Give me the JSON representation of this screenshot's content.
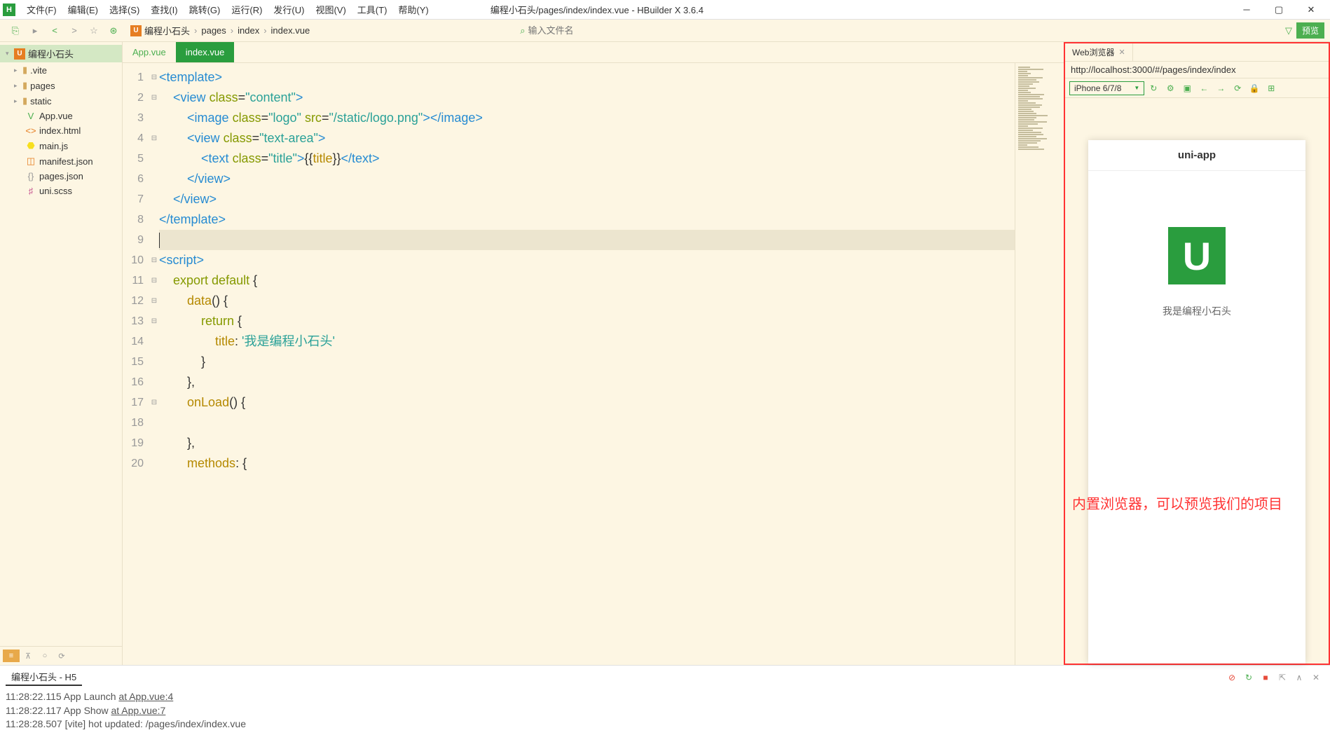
{
  "menubar": {
    "logo": "H",
    "items": [
      "文件(F)",
      "编辑(E)",
      "选择(S)",
      "查找(I)",
      "跳转(G)",
      "运行(R)",
      "发行(U)",
      "视图(V)",
      "工具(T)",
      "帮助(Y)"
    ],
    "title": "编程小石头/pages/index/index.vue - HBuilder X 3.6.4"
  },
  "toolbar": {
    "breadcrumb": [
      "编程小石头",
      "pages",
      "index",
      "index.vue"
    ],
    "search_placeholder": "输入文件名",
    "preview_label": "预览"
  },
  "sidebar": {
    "project": "编程小石头",
    "folders": [
      ".vite",
      "pages",
      "static"
    ],
    "files": [
      {
        "name": "App.vue",
        "icon": "V",
        "color": "#4caf50"
      },
      {
        "name": "index.html",
        "icon": "<>",
        "color": "#e67e22"
      },
      {
        "name": "main.js",
        "icon": "⬣",
        "color": "#f7df1e"
      },
      {
        "name": "manifest.json",
        "icon": "◫",
        "color": "#e67e22"
      },
      {
        "name": "pages.json",
        "icon": "{}",
        "color": "#999"
      },
      {
        "name": "uni.scss",
        "icon": "♯",
        "color": "#cc6699"
      }
    ]
  },
  "tabs": {
    "items": [
      "App.vue",
      "index.vue"
    ],
    "active": 1
  },
  "code": {
    "lines": [
      {
        "n": 1,
        "fold": "⊟",
        "html": "<span class='tag'>&lt;template&gt;</span>"
      },
      {
        "n": 2,
        "fold": "⊟",
        "html": "    <span class='tag'>&lt;view</span> <span class='attr'>class</span>=<span class='str'>\"content\"</span><span class='tag'>&gt;</span>"
      },
      {
        "n": 3,
        "fold": "",
        "html": "        <span class='tag'>&lt;image</span> <span class='attr'>class</span>=<span class='str'>\"logo\"</span> <span class='attr'>src</span>=<span class='str'>\"/static/logo.png\"</span><span class='tag'>&gt;&lt;/image&gt;</span>"
      },
      {
        "n": 4,
        "fold": "⊟",
        "html": "        <span class='tag'>&lt;view</span> <span class='attr'>class</span>=<span class='str'>\"text-area\"</span><span class='tag'>&gt;</span>"
      },
      {
        "n": 5,
        "fold": "",
        "html": "            <span class='tag'>&lt;text</span> <span class='attr'>class</span>=<span class='str'>\"title\"</span><span class='tag'>&gt;</span>{{<span class='var'>title</span>}}<span class='tag'>&lt;/text&gt;</span>"
      },
      {
        "n": 6,
        "fold": "",
        "html": "        <span class='tag'>&lt;/view&gt;</span>"
      },
      {
        "n": 7,
        "fold": "",
        "html": "    <span class='tag'>&lt;/view&gt;</span>"
      },
      {
        "n": 8,
        "fold": "",
        "html": "<span class='tag'>&lt;/template&gt;</span>"
      },
      {
        "n": 9,
        "fold": "",
        "html": "<span class='cursor'></span>",
        "hl": true
      },
      {
        "n": 10,
        "fold": "⊟",
        "html": "<span class='tag'>&lt;script&gt;</span>"
      },
      {
        "n": 11,
        "fold": "⊟",
        "html": "    <span class='kw'>export default</span> {"
      },
      {
        "n": 12,
        "fold": "⊟",
        "html": "        <span class='var'>data</span>() {"
      },
      {
        "n": 13,
        "fold": "⊟",
        "html": "            <span class='kw'>return</span> {"
      },
      {
        "n": 14,
        "fold": "",
        "html": "                <span class='var'>title</span>: <span class='strlit'>'我是编程小石头'</span>"
      },
      {
        "n": 15,
        "fold": "",
        "html": "            }"
      },
      {
        "n": 16,
        "fold": "",
        "html": "        },"
      },
      {
        "n": 17,
        "fold": "⊟",
        "html": "        <span class='var'>onLoad</span>() {"
      },
      {
        "n": 18,
        "fold": "",
        "html": ""
      },
      {
        "n": 19,
        "fold": "",
        "html": "        },"
      },
      {
        "n": 20,
        "fold": "",
        "html": "        <span class='var'>methods</span>: {"
      }
    ]
  },
  "preview": {
    "tab_label": "Web浏览器",
    "url": "http://localhost:3000/#/pages/index/index",
    "device": "iPhone 6/7/8",
    "header": "uni-app",
    "body_text": "我是编程小石头",
    "annotation": "内置浏览器，可以预览我们的项目"
  },
  "console": {
    "tab": "编程小石头 - H5",
    "lines": [
      {
        "ts": "11:28:22.115",
        "msg": "App Launch ",
        "link": "at App.vue:4"
      },
      {
        "ts": "11:28:22.117",
        "msg": "App Show ",
        "link": "at App.vue:7"
      },
      {
        "ts": "11:28:28.507",
        "msg": "[vite] hot updated: /pages/index/index.vue",
        "link": ""
      }
    ]
  }
}
